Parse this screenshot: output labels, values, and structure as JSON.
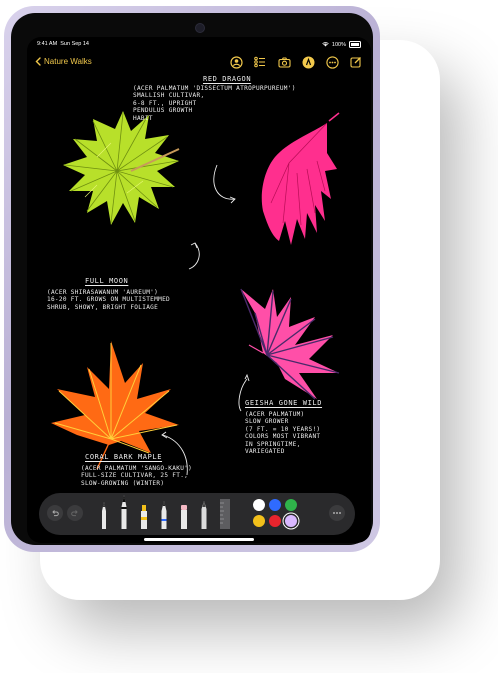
{
  "status": {
    "time": "9:41 AM",
    "date": "Sun Sep 14",
    "battery": "100%"
  },
  "nav": {
    "back_label": "Nature Walks"
  },
  "notes": {
    "red_dragon": {
      "title": "RED DRAGON",
      "body": "(ACER PALMATUM 'DISSECTUM ATROPURPUREUM')\nSMALLISH CULTIVAR,\n6-8 FT., UPRIGHT\nPENDULUS GROWTH\nHABIT"
    },
    "full_moon": {
      "title": "FULL MOON",
      "body": "(ACER SHIRASAWANUM 'AUREUM')\n16-20 FT. GROWS ON MULTISTEMMED\nSHRUB, SHOWY, BRIGHT FOLIAGE"
    },
    "geisha": {
      "title": "GEISHA GONE WILD",
      "body": "(ACER PALMATUM)\nSLOW GROWER\n(7 FT. = 10 YEARS!)\nCOLORS MOST VIBRANT\nIN SPRINGTIME,\nVARIEGATED"
    },
    "coral": {
      "title": "CORAL BARK MAPLE",
      "body": "(ACER PALMATUM 'SANGO-KAKU')\nFULL-SIZE CULTIVAR, 25 FT.,\nSLOW-GROWING (WINTER)"
    }
  },
  "colors": {
    "accent": "#f2c94c",
    "leaf_green": "#b8e02a",
    "leaf_pink": "#ff2f8e",
    "leaf_magenta": "#ff4fa8",
    "leaf_orange": "#ff6a14",
    "swatches": [
      "#ffffff",
      "#2f6bff",
      "#2fb34a",
      "#f2c01b",
      "#e8242d",
      "#d9b8ff"
    ]
  },
  "icons": {
    "nav": [
      "back-chevron-icon",
      "collaborate-icon",
      "checklist-icon",
      "camera-icon",
      "markup-icon",
      "more-icon",
      "compose-icon"
    ],
    "toolbar": [
      "undo-icon",
      "redo-icon",
      "monoline-pen-icon",
      "fountain-pen-icon",
      "highlighter-icon",
      "pencil-icon",
      "eraser-icon",
      "crayon-icon",
      "ruler-icon",
      "more-icon"
    ]
  }
}
